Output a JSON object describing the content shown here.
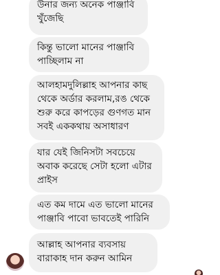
{
  "messages": [
    {
      "lines": [
        "উনার জন্য অনেক পাঞ্জাবি",
        "খুঁজেছি"
      ]
    },
    {
      "lines": [
        "কিন্তু ভালো মানের পাঞ্জাবি",
        "পাচ্ছিলাম না"
      ]
    },
    {
      "lines": [
        "আলহামদুলিল্লাহ আপনার কাছ",
        "থেকে অর্ডার করলাম,রঙ থেকে",
        "শুরু করে কাপড়ের গুণগত মান",
        "সবই এককথায় অসাধারণ"
      ]
    },
    {
      "lines": [
        "যার যেই জিনিসটা সবচেয়ে",
        "অবাক করেছে সেটা হলো এটার",
        "প্রাইস"
      ]
    },
    {
      "lines": [
        "এত কম দামে এত ভালো মানের",
        "পাঞ্জাবি পাবো ভাবতেই পারিনি"
      ]
    },
    {
      "lines": [
        "আল্লাহ আপনার ব্যবসায়",
        "বারাকাহ দান করুন আমিন"
      ]
    }
  ],
  "icons": {
    "sender_avatar": "sender-avatar",
    "seen_avatar": "seen-receipt-avatar"
  },
  "colors": {
    "bubble_bg": "#f0f0f0",
    "text": "#050505",
    "background": "#ffffff"
  }
}
